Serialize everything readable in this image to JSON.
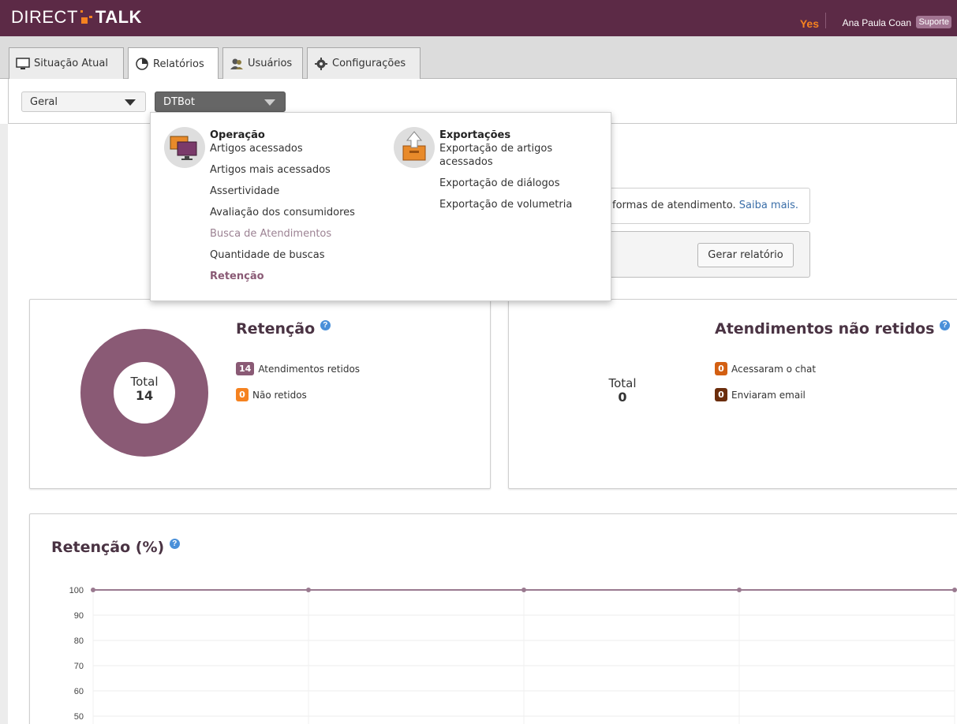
{
  "app": {
    "logo_left": "DIRECT",
    "logo_right": "TALK",
    "status": "Yes",
    "user_name": "Ana Paula Coan",
    "role_badge": "Suporte",
    "brand_color": "#5c2a46",
    "accent_color": "#f58220"
  },
  "tabs": [
    {
      "label": "Situação Atual",
      "icon": "monitor-icon",
      "active": false
    },
    {
      "label": "Relatórios",
      "icon": "pie-chart-icon",
      "active": true
    },
    {
      "label": "Usuários",
      "icon": "users-icon",
      "active": false
    },
    {
      "label": "Configurações",
      "icon": "gear-icon",
      "active": false
    }
  ],
  "filters": {
    "scope_value": "Geral",
    "bot_value": "DTBot"
  },
  "menu": {
    "operacao": {
      "title": "Operação",
      "icon": "monitors-icon",
      "items": [
        "Artigos acessados",
        "Artigos mais acessados",
        "Assertividade",
        "Avaliação dos consumidores",
        "Busca de Atendimentos",
        "Quantidade de buscas",
        "Retenção"
      ],
      "current": "Retenção"
    },
    "exportacoes": {
      "title": "Exportações",
      "icon": "export-box-icon",
      "items": [
        "Exportação de artigos acessados",
        "Exportação de diálogos",
        "Exportação de volumetria"
      ]
    }
  },
  "info": {
    "text": "formas de atendimento.",
    "link": "Saiba mais."
  },
  "generate_button": "Gerar relatório",
  "retencao_card": {
    "title": "Retenção",
    "total_label": "Total",
    "total_value": "14",
    "legend": [
      {
        "count": "14",
        "label": "Atendimentos retidos",
        "color": "#8a5a75"
      },
      {
        "count": "0",
        "label": "Não retidos",
        "color": "#f58220"
      }
    ]
  },
  "nao_retidos_card": {
    "title": "Atendimentos não retidos",
    "total_label": "Total",
    "total_value": "0",
    "legend": [
      {
        "count": "0",
        "label": "Acessaram o chat",
        "color": "#d35f12"
      },
      {
        "count": "0",
        "label": "Enviaram email",
        "color": "#6b2d0c"
      }
    ]
  },
  "chart_card": {
    "title": "Retenção (%)"
  },
  "chart_data": {
    "type": "line",
    "title": "Retenção (%)",
    "xlabel": "",
    "ylabel": "",
    "y_ticks": [
      "100",
      "90",
      "80",
      "70",
      "60",
      "50"
    ],
    "ylim": [
      50,
      100
    ],
    "series": [
      {
        "values": [
          100,
          100,
          100,
          100,
          100
        ],
        "color": "#9a7a90"
      }
    ],
    "grid": true
  }
}
